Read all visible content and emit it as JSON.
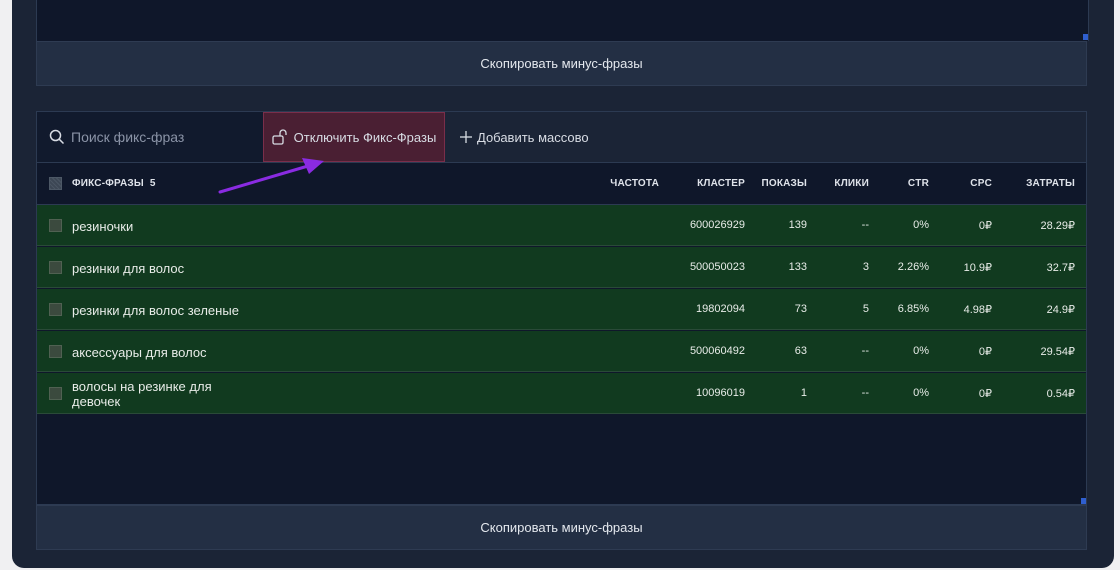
{
  "copy_button_label": "Скопировать минус-фразы",
  "toolbar": {
    "search_placeholder": "Поиск фикс-фраз",
    "unfix_label": "Отключить Фикс-Фразы",
    "bulk_add_label": "Добавить массово"
  },
  "table": {
    "headers": {
      "phrases": "ФИКС-ФРАЗЫ",
      "phrases_count": "5",
      "frequency": "ЧАСТОТА",
      "cluster": "КЛАСТЕР",
      "views": "ПОКАЗЫ",
      "clicks": "КЛИКИ",
      "ctr": "CTR",
      "cpc": "CPC",
      "cost": "ЗАТРАТЫ"
    },
    "rows": [
      {
        "phrase": "резиночки",
        "cluster": "600026929",
        "views": "139",
        "clicks": "--",
        "ctr": "0%",
        "cpc": "0₽",
        "cost": "28.29₽"
      },
      {
        "phrase": "резинки для волос",
        "cluster": "500050023",
        "views": "133",
        "clicks": "3",
        "ctr": "2.26%",
        "cpc": "10.9₽",
        "cost": "32.7₽"
      },
      {
        "phrase": "резинки для волос зеленые",
        "cluster": "19802094",
        "views": "73",
        "clicks": "5",
        "ctr": "6.85%",
        "cpc": "4.98₽",
        "cost": "24.9₽"
      },
      {
        "phrase": "аксессуары для волос",
        "cluster": "500060492",
        "views": "63",
        "clicks": "--",
        "ctr": "0%",
        "cpc": "0₽",
        "cost": "29.54₽"
      },
      {
        "phrase": "волосы на резинке для девочек",
        "cluster": "10096019",
        "views": "1",
        "clicks": "--",
        "ctr": "0%",
        "cpc": "0₽",
        "cost": "0.54₽"
      }
    ]
  },
  "colors": {
    "panel_bg": "#1b2436",
    "row_bg": "#113a1f",
    "unfix_bg": "#4a1f33",
    "annotation_arrow": "#8a2be2",
    "scroll_thumb": "#2f5fd0"
  }
}
